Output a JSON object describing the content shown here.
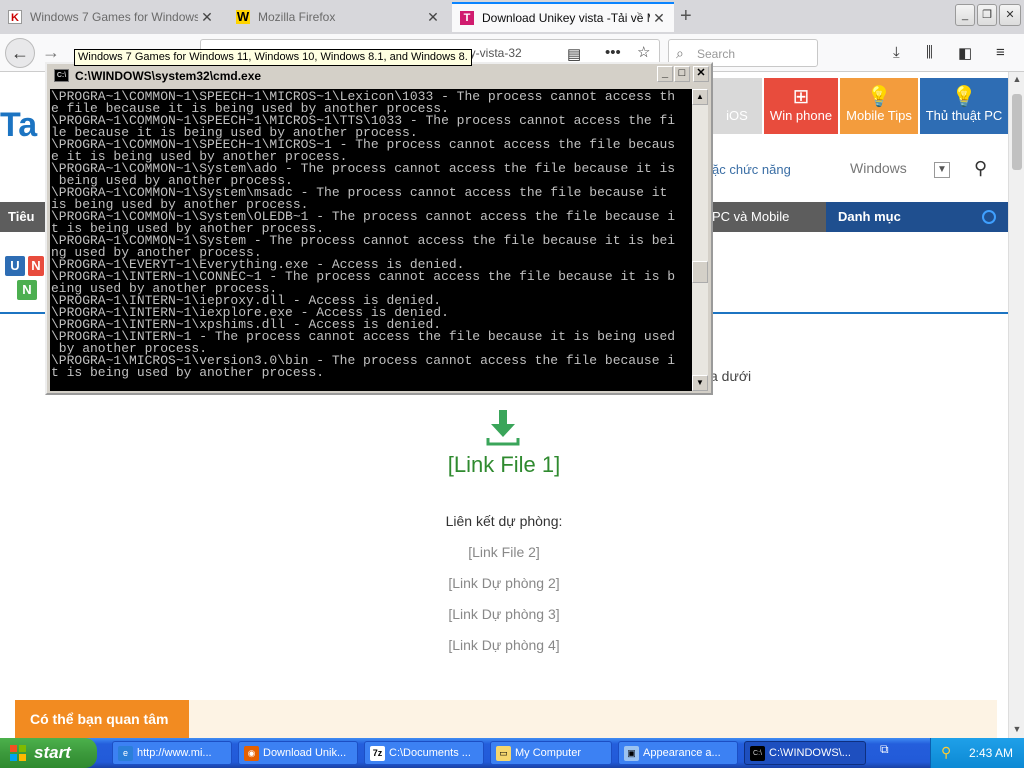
{
  "browser": {
    "tabs": [
      {
        "title": "Windows 7 Games for Windows",
        "favicon": "K",
        "active": false
      },
      {
        "title": "Mozilla Firefox",
        "favicon": "W",
        "active": false
      },
      {
        "title": "Download Unikey vista -Tải về Mới",
        "favicon": "T",
        "active": true
      }
    ],
    "url_visible": "ey-vista-32",
    "search_placeholder": "Search",
    "tooltip": "Windows 7 Games for Windows 11, Windows 10, Windows 8.1, and Windows 8."
  },
  "site": {
    "logo": "Ta",
    "categories": [
      {
        "label": "iOS",
        "icon": "apple-icon",
        "color": "#d9d9d9"
      },
      {
        "label": "Win phone",
        "icon": "windows-icon",
        "color": "#e84c3d"
      },
      {
        "label": "Mobile Tips",
        "icon": "bulb-icon",
        "color": "#f39c3d"
      },
      {
        "label": "Thủ thuật PC",
        "icon": "bulb-icon",
        "color": "#2e6db4"
      }
    ],
    "subnav_link": "ặc chức năng",
    "os_select": "Windows",
    "menu_left": "Tiêu",
    "menu_mid": "PC và Mobile",
    "menu_right": "Danh mục",
    "unikey_letters": [
      "U",
      "N",
      "N"
    ],
    "below_text": "a dưới",
    "main_link": "[Link File 1]",
    "backup_label": "Liên kết dự phòng:",
    "backup_links": [
      "[Link File 2]",
      "[Link Dự phòng 2]",
      "[Link Dự phòng 3]",
      "[Link Dự phòng 4]"
    ],
    "related_button": "Có thể bạn quan tâm"
  },
  "cmd": {
    "title": "C:\\WINDOWS\\system32\\cmd.exe",
    "output": [
      "\\PROGRA~1\\COMMON~1\\SPEECH~1\\MICROS~1\\Lexicon\\1033 - The process cannot access th",
      "e file because it is being used by another process.",
      "\\PROGRA~1\\COMMON~1\\SPEECH~1\\MICROS~1\\TTS\\1033 - The process cannot access the fi",
      "le because it is being used by another process.",
      "\\PROGRA~1\\COMMON~1\\SPEECH~1\\MICROS~1 - The process cannot access the file becaus",
      "e it is being used by another process.",
      "\\PROGRA~1\\COMMON~1\\System\\ado - The process cannot access the file because it is",
      " being used by another process.",
      "\\PROGRA~1\\COMMON~1\\System\\msadc - The process cannot access the file because it",
      "is being used by another process.",
      "\\PROGRA~1\\COMMON~1\\System\\OLEDB~1 - The process cannot access the file because i",
      "t is being used by another process.",
      "\\PROGRA~1\\COMMON~1\\System - The process cannot access the file because it is bei",
      "ng used by another process.",
      "\\PROGRA~1\\EVERYT~1\\Everything.exe - Access is denied.",
      "\\PROGRA~1\\INTERN~1\\CONNEC~1 - The process cannot access the file because it is b",
      "eing used by another process.",
      "\\PROGRA~1\\INTERN~1\\ieproxy.dll - Access is denied.",
      "\\PROGRA~1\\INTERN~1\\iexplore.exe - Access is denied.",
      "\\PROGRA~1\\INTERN~1\\xpshims.dll - Access is denied.",
      "\\PROGRA~1\\INTERN~1 - The process cannot access the file because it is being used",
      " by another process.",
      "\\PROGRA~1\\MICROS~1\\version3.0\\bin - The process cannot access the file because i",
      "t is being used by another process."
    ]
  },
  "taskbar": {
    "start_label": "start",
    "tasks": [
      {
        "label": "http://www.mi...",
        "icon": "ie-icon",
        "active": false
      },
      {
        "label": "Download Unik...",
        "icon": "firefox-icon",
        "active": false
      },
      {
        "label": "C:\\Documents ...",
        "icon": "archive-icon",
        "active": false
      },
      {
        "label": "My Computer",
        "icon": "folder-icon",
        "active": false
      },
      {
        "label": "Appearance a...",
        "icon": "display-icon",
        "active": false
      },
      {
        "label": "C:\\WINDOWS\\...",
        "icon": "cmd-icon",
        "active": true
      }
    ],
    "clock": "2:43 AM"
  }
}
